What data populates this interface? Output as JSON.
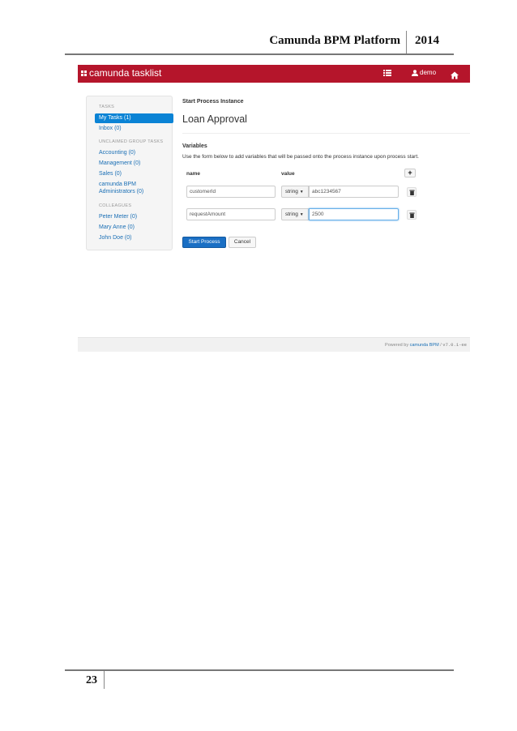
{
  "document": {
    "header_title": "Camunda BPM Platform",
    "header_year": "2014",
    "page_number": "23"
  },
  "app": {
    "brand": "camunda tasklist",
    "user": "demo",
    "accent_color": "#b5152b",
    "icons": {
      "brand": "camunda-logo-icon",
      "list": "list-icon",
      "user": "user-icon",
      "home": "home-icon",
      "add": "plus-icon",
      "delete": "trash-icon",
      "type_dropdown": "caret-down-icon"
    }
  },
  "sidebar": {
    "tasks_heading": "TASKS",
    "my_tasks": "My Tasks (1)",
    "inbox": "Inbox (0)",
    "group_heading": "UNCLAIMED GROUP TASKS",
    "groups": [
      "Accounting (0)",
      "Management (0)",
      "Sales (0)"
    ],
    "camunda_admins_line1": "camunda BPM",
    "camunda_admins_line2": "Administrators (0)",
    "colleagues_heading": "COLLEAGUES",
    "colleagues": [
      "Peter Meter (0)",
      "Mary Anne (0)",
      "John Doe (0)"
    ]
  },
  "main": {
    "breadcrumb": "Start Process Instance",
    "title": "Loan Approval",
    "variables_label": "Variables",
    "help_text": "Use the form below to add variables that will be passed onto the process instance upon process start.",
    "col_name": "name",
    "col_value": "value",
    "add_label": "+",
    "variables": [
      {
        "name": "customerId",
        "type": "string",
        "value": "abc1234567"
      },
      {
        "name": "requestAmount",
        "type": "string",
        "value": "2500"
      }
    ],
    "start_button": "Start Process",
    "cancel_button": "Cancel"
  },
  "footer": {
    "powered_prefix": "Powered by",
    "powered_link": "camunda BPM",
    "powered_sep": " / ",
    "version": "v7.0.1-ee"
  }
}
